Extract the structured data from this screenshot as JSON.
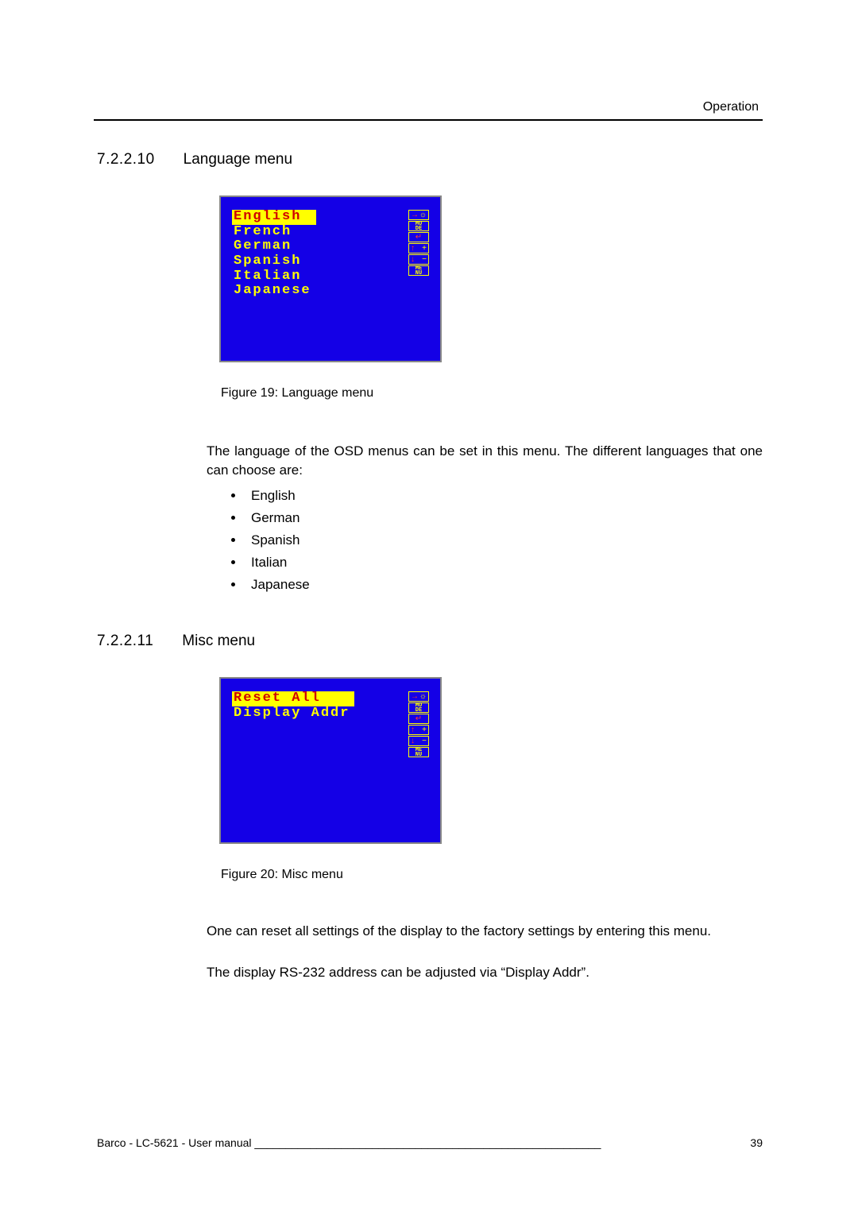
{
  "header": {
    "section_label": "Operation"
  },
  "sections": {
    "s1": {
      "number": "7.2.2.10",
      "title": "Language menu"
    },
    "s2": {
      "number": "7.2.2.11",
      "title": "Misc menu"
    }
  },
  "figures": {
    "lang": {
      "items": [
        "English",
        "French",
        "German",
        "Spanish",
        "Italian",
        "Japanese"
      ],
      "selected_index": 0,
      "caption": "Figure 19: Language menu"
    },
    "misc": {
      "items": [
        "Reset All",
        "Display Addr"
      ],
      "selected_index": 0,
      "caption": "Figure 20: Misc menu"
    },
    "nav_labels": {
      "brightness_sym": "☼",
      "mode": "MO\nDE",
      "enter": "↵",
      "up": "↑",
      "plus": "+",
      "down": "↓",
      "minus": "−",
      "menu": "ME\nNU"
    }
  },
  "body": {
    "lang_para": "The language of the OSD menus can be set in this menu. The different languages that one can choose are:",
    "lang_bullets": [
      "English",
      "German",
      "Spanish",
      "Italian",
      "Japanese"
    ],
    "misc_para1": "One can reset all settings of the display to the factory settings by entering this menu.",
    "misc_para2": "The display RS-232 address can be adjusted via “Display Addr”."
  },
  "footer": {
    "left": "Barco - LC-5621 - User manual",
    "page": "39"
  }
}
